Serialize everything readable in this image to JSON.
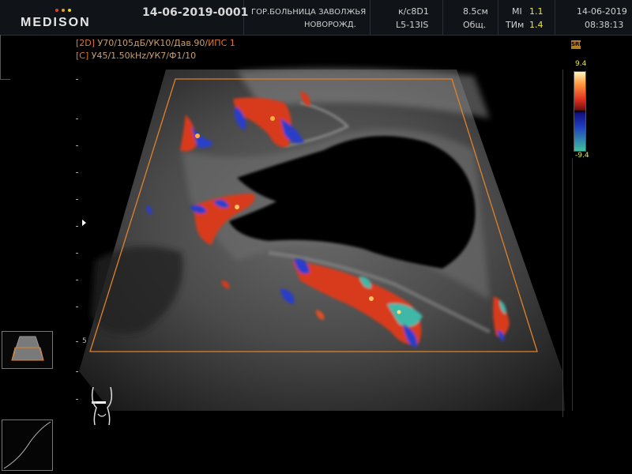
{
  "header": {
    "brand": "MEDISON",
    "brand_dot_colors": [
      "#e04030",
      "#f0a020",
      "#f0d020"
    ],
    "patient_id": "14-06-2019-0001",
    "hospital": "ГОР.БОЛЬНИЦА ЗАВОЛЖЬЯ",
    "department": "НОВОРОЖД.",
    "preset": "к/с8D1",
    "probe": "L5-13IS",
    "depth": "8.5см",
    "mode": "Общ.",
    "mi_label": "MI",
    "mi_value": "1.1",
    "tim_label": "ТИм",
    "tim_value": "1.4",
    "date": "14-06-2019",
    "time": "08:38:13"
  },
  "params": {
    "line1_tag": "[2D]",
    "line1": " У70/105дБ/УК10/Дав.90/",
    "line1_tail": "ИПС 1",
    "line2_tag": "[C]",
    "line2": " У45/1.50kHz/УК7/Ф1/10"
  },
  "scale": {
    "depth_mark": "5"
  },
  "colorbar": {
    "top": "9.4",
    "bottom": "-9.4",
    "badge": "SRF"
  },
  "colors": {
    "roi_box": "#e0822a",
    "accent_yellow": "#e8e840",
    "doppler_red": "#e03020",
    "doppler_blue": "#2040c0"
  },
  "icons": {
    "probe_thumbnail": "probe-thumbnail-icon",
    "body_marker": "body-marker-icon",
    "tgc_curve": "tgc-curve-icon",
    "focus_marker": "focus-arrow-icon"
  }
}
